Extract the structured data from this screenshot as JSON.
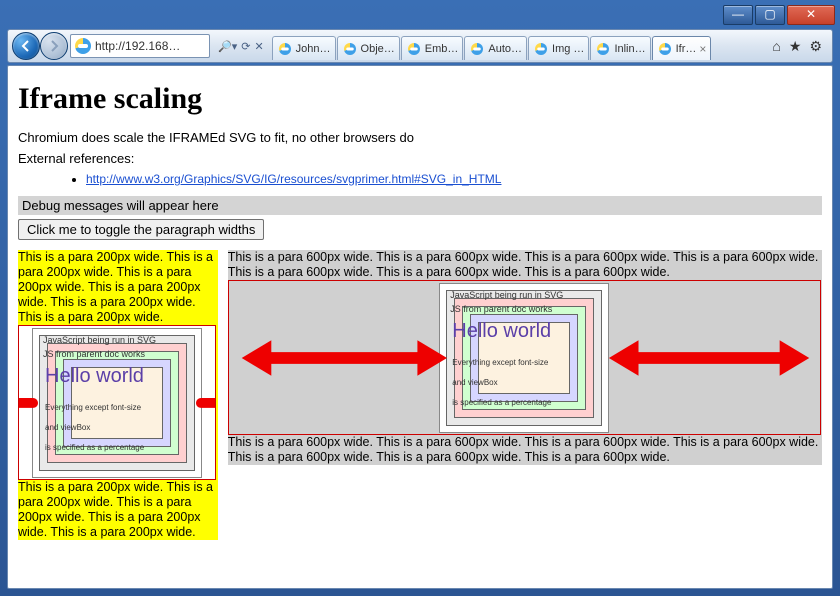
{
  "window": {
    "url": "http://192.168…",
    "tabs": [
      {
        "label": "John…"
      },
      {
        "label": "Obje…"
      },
      {
        "label": "Emb…"
      },
      {
        "label": "Auto…"
      },
      {
        "label": "Img …"
      },
      {
        "label": "Inlin…"
      },
      {
        "label": "Ifr…",
        "active": true
      }
    ]
  },
  "page": {
    "title": "Iframe scaling",
    "intro": "Chromium does scale the IFRAMEd SVG to fit, no other browsers do",
    "ext_ref_label": "External references:",
    "ext_ref_link": "http://www.w3.org/Graphics/SVG/IG/resources/svgprimer.html#SVG_in_HTML",
    "debug": "Debug messages will appear here",
    "button": "Click me to toggle the paragraph widths"
  },
  "cols": {
    "p200": "This is a para 200px wide. This is a para 200px wide. This is a para 200px wide. This is a para 200px wide. This is a para 200px wide. This is a para 200px wide.",
    "p200b": "This is a para 200px wide. This is a para 200px wide. This is a para 200px wide. This is a para 200px wide. This is a para 200px wide.",
    "p600": "This is a para 600px wide. This is a para 600px wide. This is a para 600px wide. This is a para 600px wide. This is a para 600px wide. This is a para 600px wide. This is a para 600px wide.",
    "p600b": "This is a para 600px wide. This is a para 600px wide. This is a para 600px wide. This is a para 600px wide. This is a para 600px wide. This is a para 600px wide. This is a para 600px wide."
  },
  "svg": {
    "line1": "JavaScript being run in SVG",
    "line2": "JS from parent doc works",
    "hello": "Hello world",
    "line3": "Everything except font-size",
    "line4": "and viewBox",
    "line5": "is specified as a percentage"
  }
}
